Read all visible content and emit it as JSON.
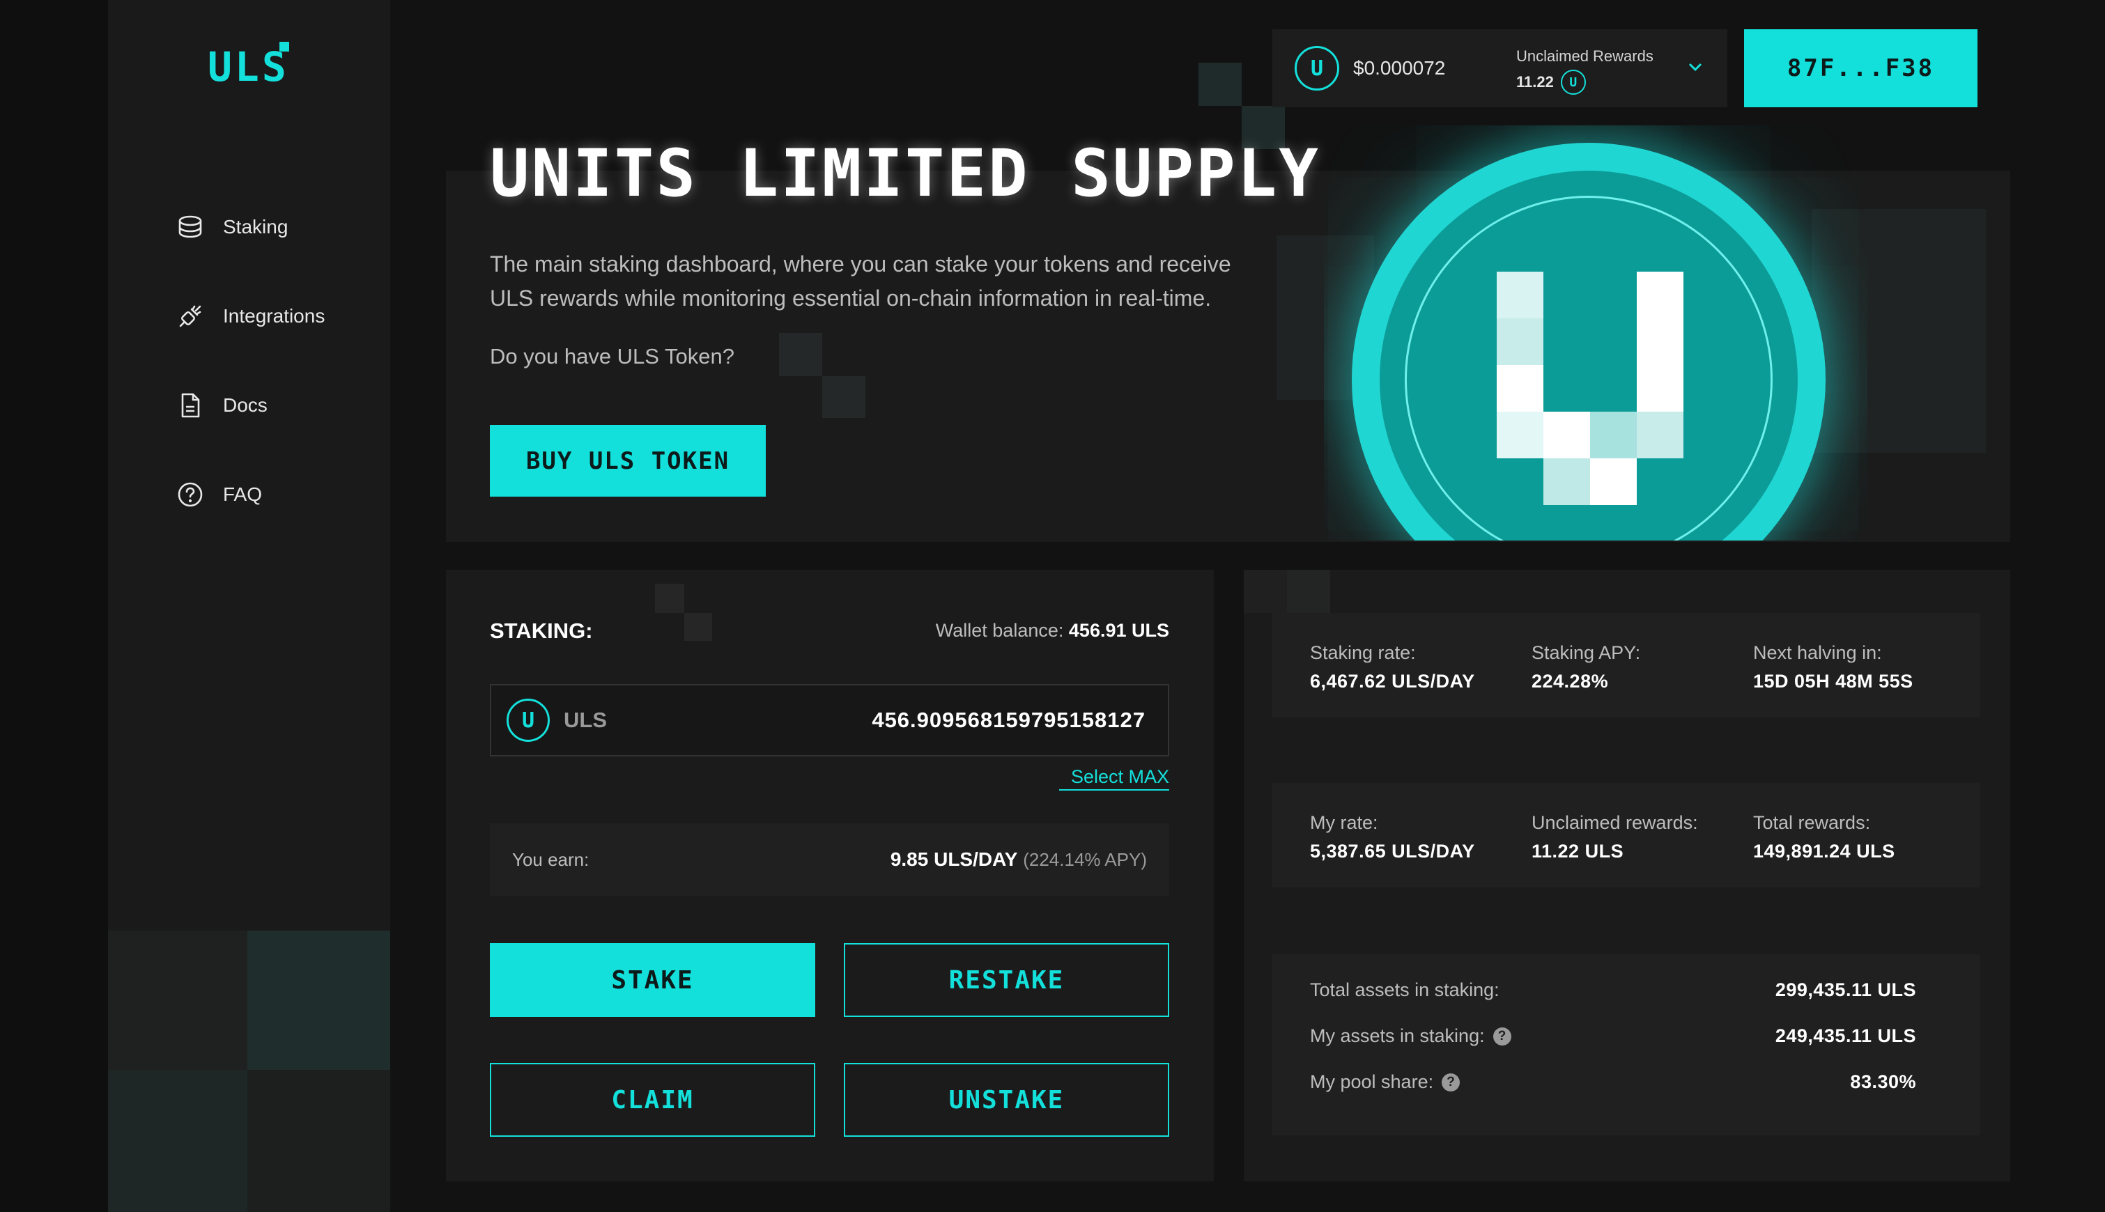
{
  "brand": {
    "logo_text": "ULS",
    "accent": "#14e0db"
  },
  "sidebar": {
    "items": [
      {
        "label": "Staking",
        "icon": "coins-stack-icon"
      },
      {
        "label": "Integrations",
        "icon": "plug-icon"
      },
      {
        "label": "Docs",
        "icon": "document-icon"
      },
      {
        "label": "FAQ",
        "icon": "question-circle-icon"
      }
    ]
  },
  "topbar": {
    "price": "$0.000072",
    "rewards_label": "Unclaimed Rewards",
    "rewards_value": "11.22",
    "wallet_button": "87F...F38"
  },
  "hero": {
    "title": "UNITS LIMITED SUPPLY",
    "description": "The main staking dashboard, where you can stake your tokens and receive ULS rewards while monitoring essential on-chain information in real-time.",
    "question": "Do you have ULS Token?",
    "buy_button": "BUY ULS TOKEN"
  },
  "staking": {
    "title": "STAKING:",
    "wallet_balance_label": "Wallet balance:",
    "wallet_balance_value": "456.91 ULS",
    "token": "ULS",
    "amount_value": "456.909568159795158127",
    "select_max": "Select MAX",
    "earn_label": "You earn:",
    "earn_value": "9.85 ULS/DAY",
    "earn_apy": "(224.14% APY)",
    "buttons": {
      "stake": "STAKE",
      "restake": "RESTAKE",
      "claim": "CLAIM",
      "unstake": "UNSTAKE"
    }
  },
  "stats": {
    "global": [
      {
        "label": "Staking rate:",
        "value": "6,467.62 ULS/DAY"
      },
      {
        "label": "Staking APY:",
        "value": "224.28%"
      },
      {
        "label": "Next halving in:",
        "value": "15D 05H 48M 55S"
      }
    ],
    "mine": [
      {
        "label": "My rate:",
        "value": "5,387.65 ULS/DAY"
      },
      {
        "label": "Unclaimed rewards:",
        "value": "11.22 ULS"
      },
      {
        "label": "Total rewards:",
        "value": "149,891.24 ULS"
      }
    ],
    "pool": [
      {
        "label": "Total assets in staking:",
        "value": "299,435.11 ULS"
      },
      {
        "label": "My assets in staking:",
        "value": "249,435.11 ULS"
      },
      {
        "label": "My pool share:",
        "value": "83.30%"
      }
    ]
  }
}
